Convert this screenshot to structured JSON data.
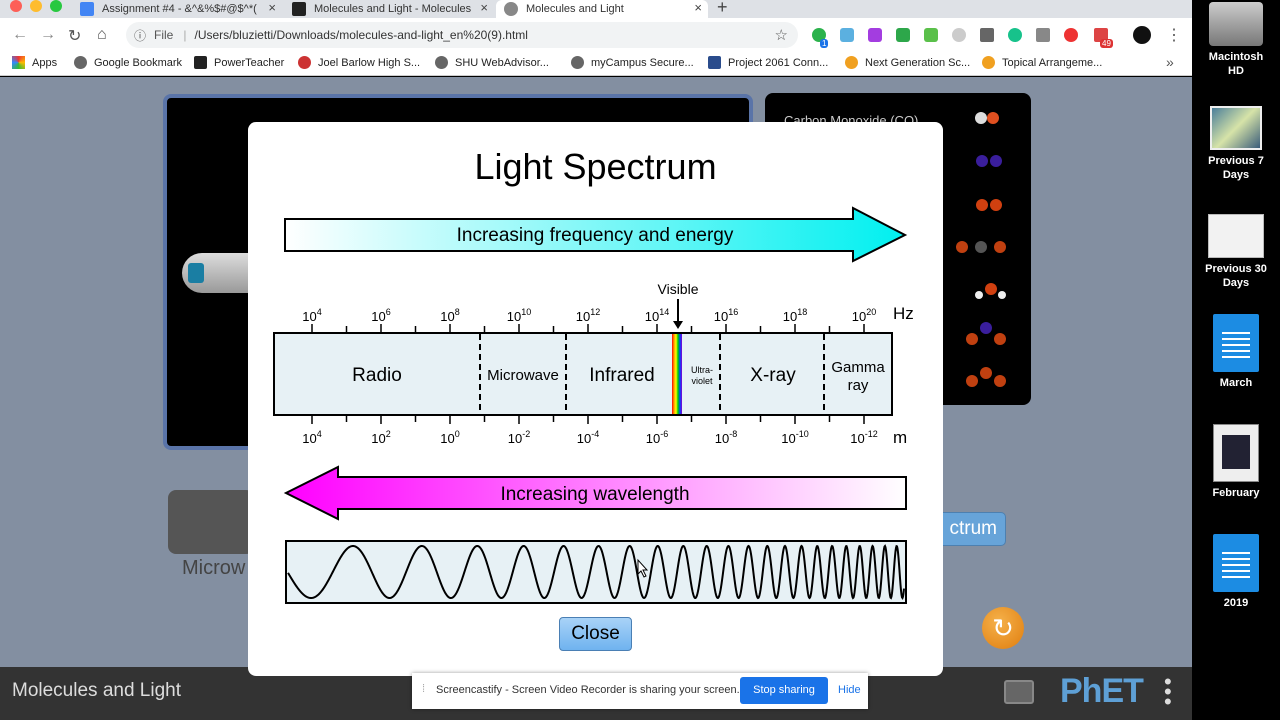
{
  "browser": {
    "tabs": [
      {
        "title": "Assignment #4 - &^&%$#@$^*(",
        "favicon_color": "#4285f4"
      },
      {
        "title": "Molecules and Light - Molecules",
        "favicon_color": "#222222"
      },
      {
        "title": "Molecules and Light",
        "favicon_color": "#888888"
      }
    ],
    "new_tab_symbol": "+",
    "close_symbol": "×",
    "file_label": "File",
    "url": "/Users/bluzietti/Downloads/molecules-and-light_en%20(9).html",
    "star_symbol": "☆",
    "menu_symbol": "⋮",
    "extension_badges": [
      "1",
      "49"
    ],
    "bookmarks": [
      {
        "label": "Apps"
      },
      {
        "label": "Google Bookmark"
      },
      {
        "label": "PowerTeacher"
      },
      {
        "label": "Joel Barlow High S..."
      },
      {
        "label": "SHU WebAdvisor..."
      },
      {
        "label": "myCampus Secure..."
      },
      {
        "label": "Project 2061 Conn..."
      },
      {
        "label": "Next Generation Sc..."
      },
      {
        "label": "Topical Arrangeme..."
      }
    ],
    "bookmarks_overflow": "»"
  },
  "sim": {
    "molecule_label": "Carbon Monoxide (CO)",
    "microwave_label": "Microw",
    "spectrum_button_label": "ctrum",
    "title": "Molecules and Light",
    "phet_logo": "PhET",
    "reset_symbol": "↻"
  },
  "dialog": {
    "title": "Light Spectrum",
    "frequency_arrow_label": "Increasing frequency and energy",
    "wavelength_arrow_label": "Increasing wavelength",
    "visible_label": "Visible",
    "frequency_unit": "Hz",
    "wavelength_unit": "m",
    "frequency_ticks": [
      {
        "base": "10",
        "exp": "4"
      },
      {
        "base": "10",
        "exp": "6"
      },
      {
        "base": "10",
        "exp": "8"
      },
      {
        "base": "10",
        "exp": "10"
      },
      {
        "base": "10",
        "exp": "12"
      },
      {
        "base": "10",
        "exp": "14"
      },
      {
        "base": "10",
        "exp": "16"
      },
      {
        "base": "10",
        "exp": "18"
      },
      {
        "base": "10",
        "exp": "20"
      }
    ],
    "wavelength_ticks": [
      {
        "base": "10",
        "exp": "4"
      },
      {
        "base": "10",
        "exp": "2"
      },
      {
        "base": "10",
        "exp": "0"
      },
      {
        "base": "10",
        "exp": "-2"
      },
      {
        "base": "10",
        "exp": "-4"
      },
      {
        "base": "10",
        "exp": "-6"
      },
      {
        "base": "10",
        "exp": "-8"
      },
      {
        "base": "10",
        "exp": "-10"
      },
      {
        "base": "10",
        "exp": "-12"
      }
    ],
    "bands": [
      {
        "name": "Radio"
      },
      {
        "name": "Microwave"
      },
      {
        "name": "Infrared"
      },
      {
        "name": "Ultra-",
        "name2": "violet"
      },
      {
        "name": "X-ray"
      },
      {
        "name": "Gamma",
        "name2": "ray"
      }
    ],
    "close_label": "Close",
    "colors": {
      "frequency_arrow": "#00f0f0",
      "wavelength_arrow": "#ff00ff",
      "band_fill": "#e7f1f5"
    }
  },
  "screencastify": {
    "message": "Screencastify - Screen Video Recorder is sharing your screen.",
    "stop_label": "Stop sharing",
    "hide_label": "Hide"
  },
  "desktop": {
    "icons": [
      {
        "label": "Macintosh",
        "label2": "HD",
        "icon": "hard-drive-icon"
      },
      {
        "label": "Previous 7",
        "label2": "Days",
        "icon": "folder-thumbnail-icon"
      },
      {
        "label": "Previous 30",
        "label2": "Days",
        "icon": "folder-thumbnail-icon"
      },
      {
        "label": "March",
        "label2": "",
        "icon": "document-icon"
      },
      {
        "label": "February",
        "label2": "",
        "icon": "document-icon"
      },
      {
        "label": "2019",
        "label2": "",
        "icon": "document-icon"
      }
    ]
  }
}
